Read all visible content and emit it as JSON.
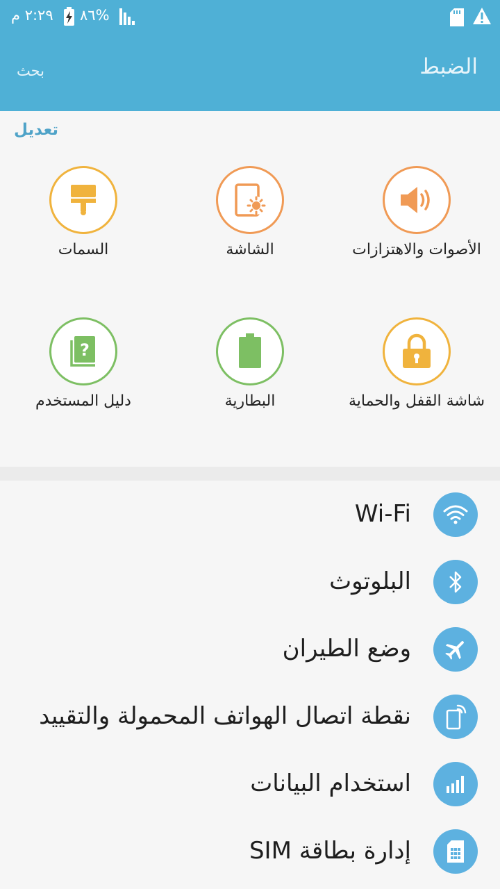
{
  "status_bar": {
    "time": "٢:٢٩ م",
    "battery_percent": "%٨٦",
    "icons": [
      "signal-icon",
      "battery-charging-icon",
      "sd-card-icon",
      "alert-icon"
    ]
  },
  "app_bar": {
    "title": "الضبط",
    "search_label": "بحث"
  },
  "quick_settings": {
    "edit_label": "تعديل",
    "tiles": [
      {
        "label": "الأصوات والاهتزازات",
        "icon": "speaker-icon",
        "color": "#f09a55"
      },
      {
        "label": "الشاشة",
        "icon": "display-brightness-icon",
        "color": "#f09a55"
      },
      {
        "label": "السمات",
        "icon": "paint-brush-icon",
        "color": "#f0b33d"
      },
      {
        "label": "شاشة القفل والحماية",
        "icon": "lock-icon",
        "color": "#f0b33d"
      },
      {
        "label": "البطارية",
        "icon": "battery-icon",
        "color": "#7dbf63"
      },
      {
        "label": "دليل المستخدم",
        "icon": "user-manual-icon",
        "color": "#7dbf63"
      }
    ]
  },
  "settings_list": {
    "accent": "#5db1e0",
    "items": [
      {
        "label": "Wi-Fi",
        "icon": "wifi-icon"
      },
      {
        "label": "البلوتوث",
        "icon": "bluetooth-icon"
      },
      {
        "label": "وضع الطيران",
        "icon": "airplane-icon"
      },
      {
        "label": "نقطة اتصال الهواتف المحمولة والتقييد",
        "icon": "hotspot-icon"
      },
      {
        "label": "استخدام البيانات",
        "icon": "data-usage-icon"
      },
      {
        "label": "إدارة بطاقة SIM",
        "icon": "sim-card-icon"
      }
    ]
  }
}
